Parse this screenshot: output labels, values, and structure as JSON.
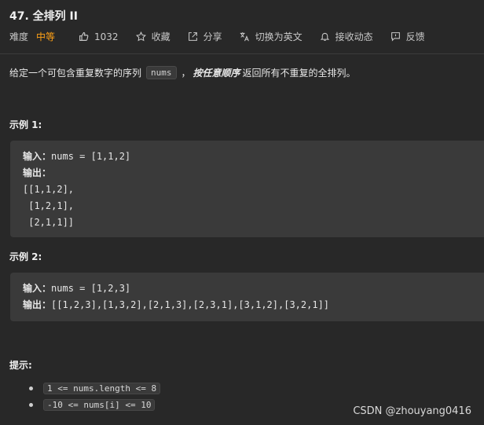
{
  "problem": {
    "title": "47. 全排列 II",
    "difficulty_label": "难度",
    "difficulty_value": "中等",
    "likes": "1032",
    "favorite_label": "收藏",
    "share_label": "分享",
    "translate_label": "切换为英文",
    "subscribe_label": "接收动态",
    "feedback_label": "反馈",
    "colors": {
      "medium": "#ffa116",
      "background": "#282828",
      "code_bg": "#3a3a3a"
    }
  },
  "description": {
    "prefix": "给定一个可包含重复数字的序列",
    "code": "nums",
    "comma": "，",
    "emphasis": "按任意顺序",
    "suffix": "返回所有不重复的全排列。"
  },
  "examples": [
    {
      "heading": "示例 1:",
      "input_label": "输入：",
      "input_value": "nums = [1,1,2]",
      "output_label": "输出：",
      "output_lines": [
        "[[1,1,2],",
        " [1,2,1],",
        " [2,1,1]]"
      ]
    },
    {
      "heading": "示例 2:",
      "input_label": "输入：",
      "input_value": "nums = [1,2,3]",
      "output_label": "输出：",
      "output_value": "[[1,2,3],[1,3,2],[2,1,3],[2,3,1],[3,1,2],[3,2,1]]"
    }
  ],
  "hints": {
    "heading": "提示:",
    "items": [
      "1 <= nums.length <= 8",
      "-10 <= nums[i] <= 10"
    ]
  },
  "watermark": "CSDN @zhouyang0416",
  "icons": [
    "thumbs-up-icon",
    "star-icon",
    "share-icon",
    "translate-icon",
    "bell-icon",
    "feedback-icon"
  ]
}
